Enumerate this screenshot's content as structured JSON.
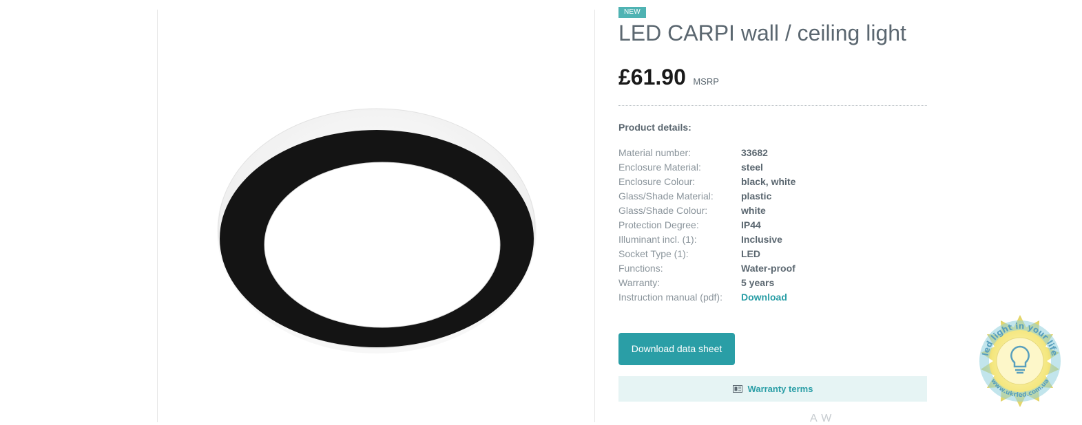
{
  "product": {
    "badge": "NEW",
    "title": "LED CARPI wall / ceiling light",
    "price": "£61.90",
    "price_note": "MSRP"
  },
  "details": {
    "heading": "Product details:",
    "specs": [
      {
        "label": "Material number:",
        "value": "33682"
      },
      {
        "label": "Enclosure Material:",
        "value": "steel"
      },
      {
        "label": "Enclosure Colour:",
        "value": "black, white"
      },
      {
        "label": "Glass/Shade Material:",
        "value": "plastic"
      },
      {
        "label": "Glass/Shade Colour:",
        "value": "white"
      },
      {
        "label": "Protection Degree:",
        "value": "IP44"
      },
      {
        "label": "Illuminant incl. (1):",
        "value": "Inclusive"
      },
      {
        "label": "Socket Type (1):",
        "value": "LED"
      },
      {
        "label": "Functions:",
        "value": "Water-proof"
      },
      {
        "label": "Warranty:",
        "value": "5 years"
      },
      {
        "label": "Instruction manual (pdf):",
        "value": "Download"
      }
    ]
  },
  "actions": {
    "datasheet_label": "Download data sheet",
    "warranty_label": "Warranty terms",
    "warranty_icon": "document-icon"
  },
  "footer_cutoff_text": "A    W",
  "watermark": {
    "text": "led light in your life",
    "url": "www.ukrled.com.ua"
  },
  "colors": {
    "accent": "#2a9ea6",
    "badge": "#4fb3b3",
    "warranty_bg": "#e6f4f4",
    "title": "#5b6770"
  }
}
